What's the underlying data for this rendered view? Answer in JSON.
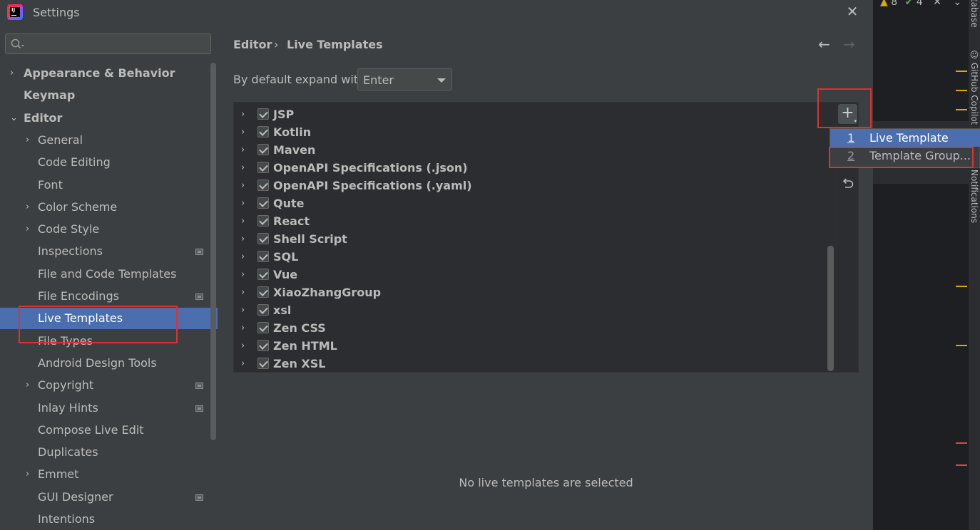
{
  "window": {
    "title": "Settings",
    "close_glyph": "✕",
    "logo_text": "IJ"
  },
  "search": {
    "placeholder": ""
  },
  "nav": [
    {
      "label": "Appearance & Behavior",
      "bold": true,
      "chevron": "›",
      "indent": 0
    },
    {
      "label": "Keymap",
      "bold": true,
      "chevron": "",
      "indent": 0
    },
    {
      "label": "Editor",
      "bold": true,
      "chevron": "⌄",
      "indent": 0
    },
    {
      "label": "General",
      "chevron": "›",
      "indent": 1
    },
    {
      "label": "Code Editing",
      "chevron": "",
      "indent": 1
    },
    {
      "label": "Font",
      "chevron": "",
      "indent": 1
    },
    {
      "label": "Color Scheme",
      "chevron": "›",
      "indent": 1
    },
    {
      "label": "Code Style",
      "chevron": "›",
      "indent": 1
    },
    {
      "label": "Inspections",
      "chevron": "",
      "indent": 1,
      "project": true
    },
    {
      "label": "File and Code Templates",
      "chevron": "",
      "indent": 1
    },
    {
      "label": "File Encodings",
      "chevron": "",
      "indent": 1,
      "project": true
    },
    {
      "label": "Live Templates",
      "chevron": "",
      "indent": 1,
      "selected": true
    },
    {
      "label": "File Types",
      "chevron": "",
      "indent": 1
    },
    {
      "label": "Android Design Tools",
      "chevron": "",
      "indent": 1
    },
    {
      "label": "Copyright",
      "chevron": "›",
      "indent": 1,
      "project": true
    },
    {
      "label": "Inlay Hints",
      "chevron": "",
      "indent": 1,
      "project": true
    },
    {
      "label": "Compose Live Edit",
      "chevron": "",
      "indent": 1
    },
    {
      "label": "Duplicates",
      "chevron": "",
      "indent": 1
    },
    {
      "label": "Emmet",
      "chevron": "›",
      "indent": 1
    },
    {
      "label": "GUI Designer",
      "chevron": "",
      "indent": 1,
      "project": true
    },
    {
      "label": "Intentions",
      "chevron": "",
      "indent": 1
    }
  ],
  "breadcrumb": {
    "parent": "Editor",
    "separator": "›",
    "current": "Live Templates",
    "back": "←",
    "forward": "→"
  },
  "expand": {
    "label": "By default expand with",
    "value": "Enter"
  },
  "groups": [
    "JSP",
    "Kotlin",
    "Maven",
    "OpenAPI Specifications (.json)",
    "OpenAPI Specifications (.yaml)",
    "Qute",
    "React",
    "Shell Script",
    "SQL",
    "Vue",
    "XiaoZhangGroup",
    "xsl",
    "Zen CSS",
    "Zen HTML",
    "Zen XSL"
  ],
  "group_chevron": "›",
  "toolbar": {
    "add": "+",
    "add_dropdown": "▾"
  },
  "add_menu": [
    {
      "num": "1",
      "label": "Live Template",
      "selected": true
    },
    {
      "num": "2",
      "label": "Template Group..."
    }
  ],
  "empty_message": "No live templates are selected",
  "ide": {
    "warnings": "8",
    "checks": "4",
    "tool_windows": [
      "tabase",
      "GitHub Copilot",
      "Notifications"
    ],
    "colors": {
      "warning": "#e0a800",
      "error": "#c94f4f",
      "accent": "#4b6eaf"
    }
  }
}
